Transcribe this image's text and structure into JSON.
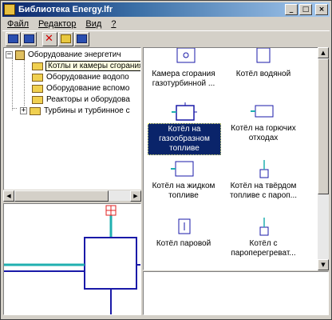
{
  "window": {
    "title": "Библиотека Energy.lfr",
    "controls": {
      "minimize": "_",
      "maximize": "□",
      "close": "×"
    }
  },
  "menu": [
    {
      "label": "Файл",
      "underline_index": 0
    },
    {
      "label": "Редактор",
      "underline_index": 0
    },
    {
      "label": "Вид",
      "underline_index": 0
    },
    {
      "label": "?",
      "underline_index": 0
    }
  ],
  "toolbar": {
    "buttons": [
      "import-icon",
      "export-icon",
      "delete-icon",
      "new-folder-icon",
      "properties-icon"
    ]
  },
  "tree": {
    "root": {
      "label": "Оборудование энергетич",
      "expander": "−"
    },
    "children": [
      {
        "label": "Котлы и камеры сгорания",
        "tooltip": true
      },
      {
        "label": "Оборудование водопо"
      },
      {
        "label": "Оборудование вспомо"
      },
      {
        "label": "Реакторы и оборудова"
      },
      {
        "label": "Турбины и турбинное с",
        "expander": "+"
      }
    ]
  },
  "library_items": [
    {
      "label": "Камера сгорания газотурбинной ...",
      "icon": "combustion-chamber-icon",
      "selected": false
    },
    {
      "label": "Котёл водяной",
      "icon": "water-boiler-icon",
      "selected": false
    },
    {
      "label": "Котёл на газообразном топливе",
      "icon": "gas-boiler-icon",
      "selected": true
    },
    {
      "label": "Котёл на горючих отходах",
      "icon": "waste-boiler-icon",
      "selected": false
    },
    {
      "label": "Котёл на жидком топливе",
      "icon": "liquid-fuel-boiler-icon",
      "selected": false
    },
    {
      "label": "Котёл на твёрдом топливе с пароп...",
      "icon": "solid-fuel-boiler-icon",
      "selected": false
    },
    {
      "label": "Котёл паровой",
      "icon": "steam-boiler-icon",
      "selected": false
    },
    {
      "label": "Котёл с пароперегреват...",
      "icon": "superheater-boiler-icon",
      "selected": false
    }
  ],
  "colors": {
    "title_active": "#0a246a",
    "selection": "#0a246a",
    "preview_stroke": "#1a1aa8",
    "preview_pipe": "#20b0b0",
    "preview_port": "#e02020"
  }
}
